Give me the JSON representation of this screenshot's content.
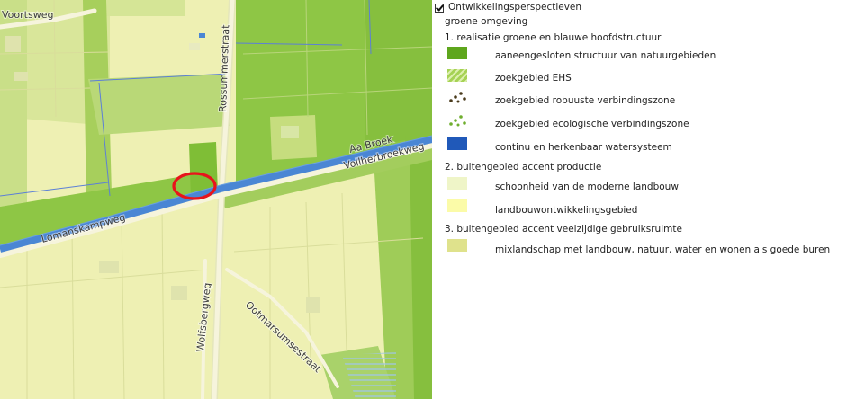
{
  "map": {
    "street_labels": [
      "Voortsweg",
      "Rossummerstraat",
      "Aa Broek",
      "Vollherbroekweg",
      "Lomanskampweg",
      "Wolfsbergweg",
      "Ootmarsumsestraat"
    ],
    "colors": {
      "pale_yellow": "#eef0b3",
      "light_green": "#c5dd7f",
      "medium_green": "#8ec645",
      "road": "#f6f4dc",
      "water": "#4a86d4",
      "marker": "#e8141b"
    }
  },
  "legend": {
    "layer_title": "Ontwikkelingsperspectieven",
    "layer_checked": true,
    "group_title": "groene omgeving",
    "sections": [
      {
        "title": "1. realisatie groene en blauwe hoofdstructuur",
        "items": [
          {
            "label": "aaneengesloten structuur van natuurgebieden",
            "swatch": "solid",
            "color": "#5ea61d"
          },
          {
            "label": "zoekgebied EHS",
            "swatch": "hatch",
            "color": "#a6d255"
          },
          {
            "label": "zoekgebied robuuste verbindingszone",
            "swatch": "dots",
            "color": "#4a3b1c"
          },
          {
            "label": "zoekgebied ecologische verbindingszone",
            "swatch": "dots",
            "color": "#6fae2e"
          },
          {
            "label": "continu en herkenbaar watersysteem",
            "swatch": "solid",
            "color": "#2059b9"
          }
        ]
      },
      {
        "title": "2. buitengebied accent productie",
        "items": [
          {
            "label": "schoonheid van de moderne landbouw",
            "swatch": "solid",
            "color": "#eff5c8"
          },
          {
            "label": "landbouwontwikkelingsgebied",
            "swatch": "solid",
            "color": "#fbfba8"
          }
        ]
      },
      {
        "title": "3. buitengebied accent veelzijdige gebruiksruimte",
        "items": [
          {
            "label": "mixlandschap met landbouw, natuur, water en wonen als goede buren",
            "swatch": "solid",
            "color": "#dfe28c"
          }
        ]
      }
    ]
  }
}
